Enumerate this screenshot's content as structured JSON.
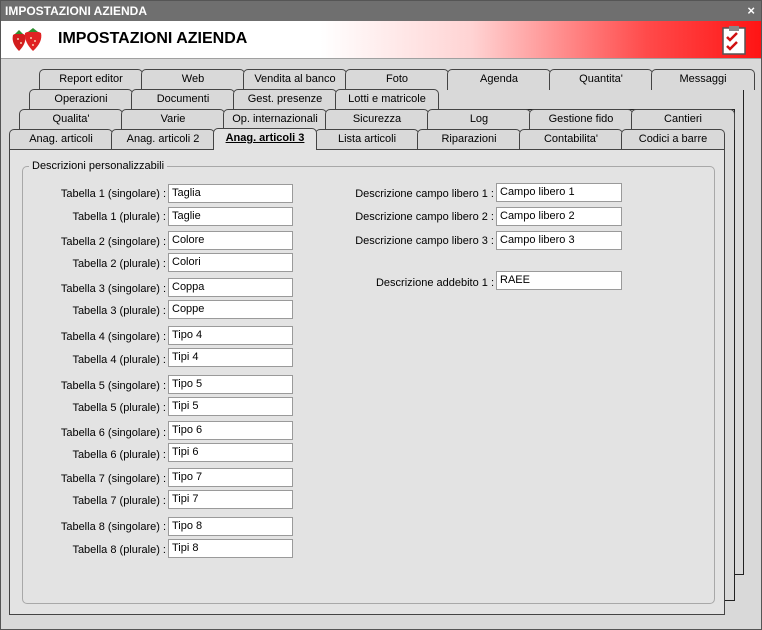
{
  "window": {
    "title": "IMPOSTAZIONI AZIENDA",
    "close": "×"
  },
  "header": {
    "title": "IMPOSTAZIONI AZIENDA"
  },
  "tabs": {
    "row1": [
      "Report editor",
      "Web",
      "Vendita al banco",
      "Foto",
      "Agenda",
      "Quantita'",
      "Messaggi"
    ],
    "row2": [
      "Operazioni",
      "Documenti",
      "Gest. presenze",
      "Lotti e matricole"
    ],
    "row3": [
      "Qualita'",
      "Varie",
      "Op. internazionali",
      "Sicurezza",
      "Log",
      "Gestione fido",
      "Cantieri"
    ],
    "row4": [
      "Anag. articoli",
      "Anag. articoli 2",
      "Anag. articoli 3",
      "Lista articoli",
      "Riparazioni",
      "Contabilita'",
      "Codici a barre"
    ]
  },
  "group": {
    "legend": "Descrizioni personalizzabili"
  },
  "tables": [
    {
      "label": "Tabella 1 (singolare) :",
      "value": "Taglia"
    },
    {
      "label": "Tabella 1 (plurale) :",
      "value": "Taglie"
    },
    {
      "label": "Tabella 2 (singolare) :",
      "value": "Colore"
    },
    {
      "label": "Tabella 2 (plurale) :",
      "value": "Colori"
    },
    {
      "label": "Tabella 3 (singolare) :",
      "value": "Coppa"
    },
    {
      "label": "Tabella 3 (plurale) :",
      "value": "Coppe"
    },
    {
      "label": "Tabella 4 (singolare) :",
      "value": "Tipo 4"
    },
    {
      "label": "Tabella 4 (plurale) :",
      "value": "Tipi 4"
    },
    {
      "label": "Tabella 5 (singolare) :",
      "value": "Tipo 5"
    },
    {
      "label": "Tabella 5 (plurale) :",
      "value": "Tipi 5"
    },
    {
      "label": "Tabella 6 (singolare) :",
      "value": "Tipo 6"
    },
    {
      "label": "Tabella 6 (plurale) :",
      "value": "Tipi 6"
    },
    {
      "label": "Tabella 7 (singolare) :",
      "value": "Tipo 7"
    },
    {
      "label": "Tabella 7 (plurale) :",
      "value": "Tipi 7"
    },
    {
      "label": "Tabella 8 (singolare) :",
      "value": "Tipo 8"
    },
    {
      "label": "Tabella 8 (plurale) :",
      "value": "Tipi 8"
    }
  ],
  "fields": [
    {
      "label": "Descrizione campo libero 1 :",
      "value": "Campo libero 1"
    },
    {
      "label": "Descrizione campo libero 2 :",
      "value": "Campo libero 2"
    },
    {
      "label": "Descrizione campo libero 3 :",
      "value": "Campo libero 3"
    },
    {
      "label": "Descrizione addebito 1 :",
      "value": "RAEE"
    }
  ]
}
